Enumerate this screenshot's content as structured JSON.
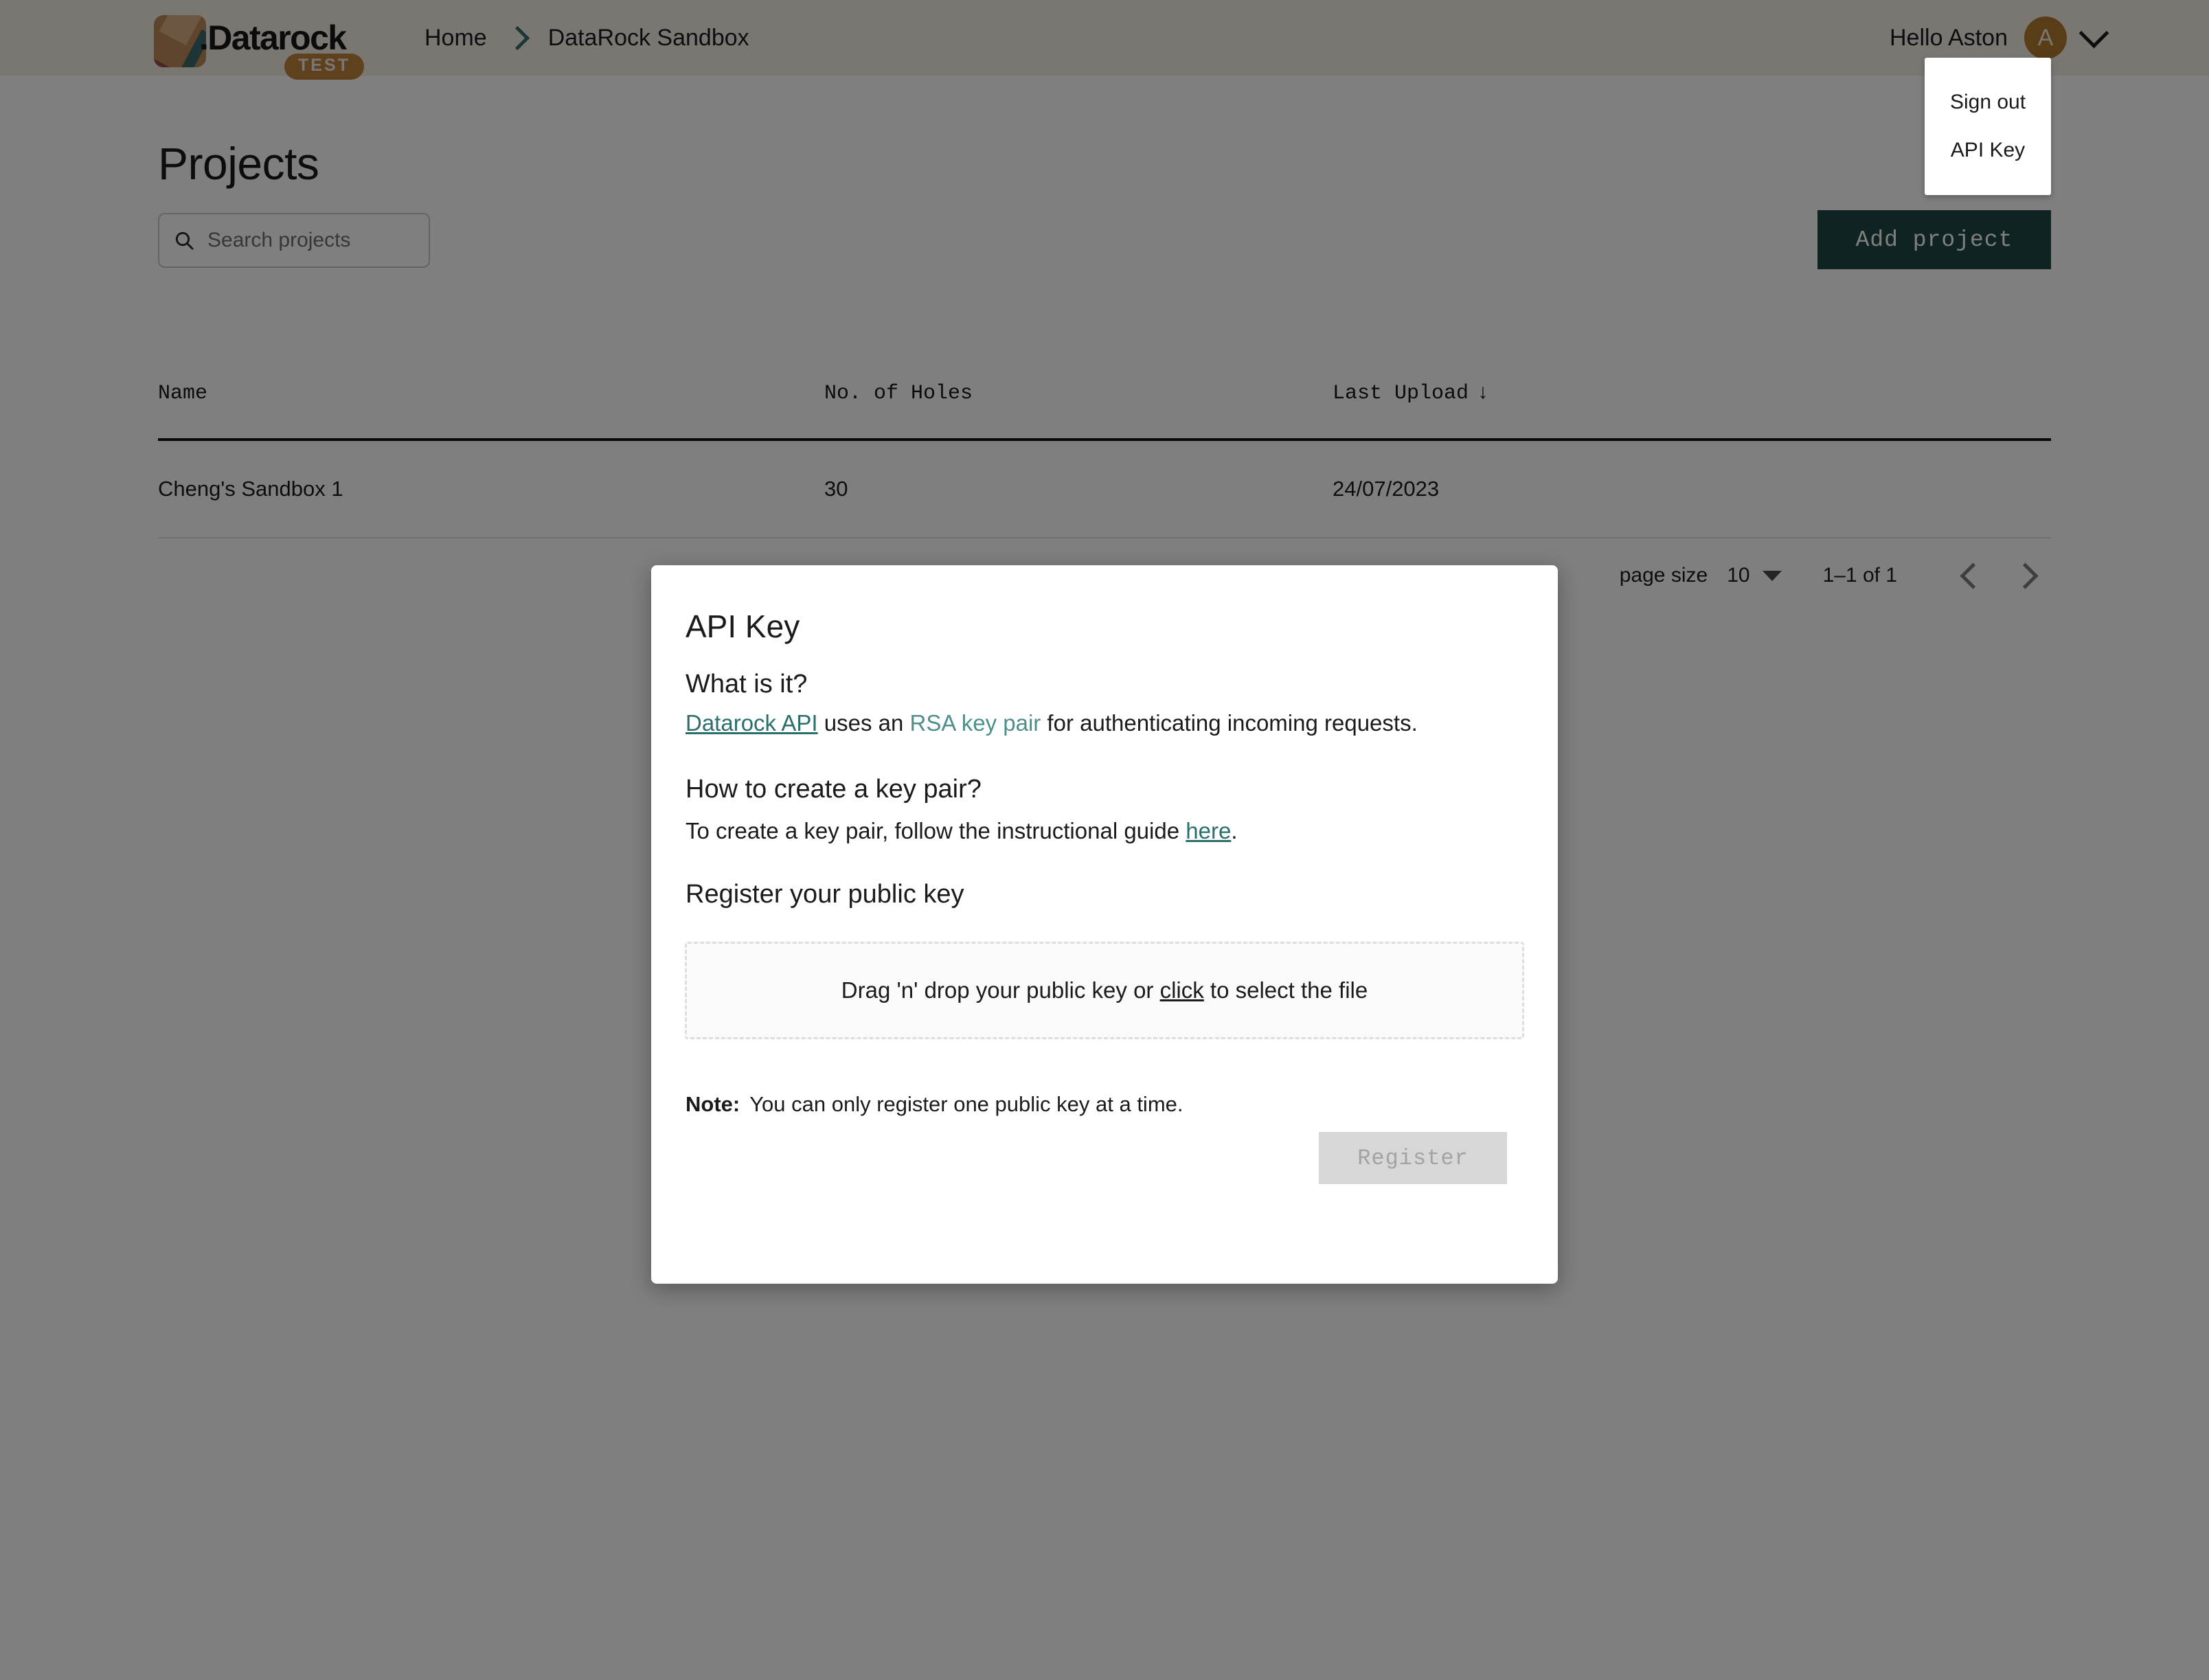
{
  "topbar": {
    "logo_word": ".Datarock",
    "logo_badge": "TEST",
    "breadcrumb": [
      {
        "label": "Home",
        "icon": ""
      },
      {
        "label": "DataRock Sandbox",
        "icon": "chevron-right-icon"
      }
    ],
    "greeting": "Hello Aston",
    "avatar_initial": "A",
    "caret_icon": "chevron-down-icon"
  },
  "user_menu": {
    "items": [
      {
        "label": "Sign out"
      },
      {
        "label": "API Key"
      }
    ]
  },
  "page": {
    "title": "Projects"
  },
  "search": {
    "placeholder": "Search projects",
    "value": "",
    "icon": "search-icon"
  },
  "toolbar": {
    "add_project_label": "Add project"
  },
  "table": {
    "columns": [
      {
        "label": "Name",
        "sort": ""
      },
      {
        "label": "No. of Holes",
        "sort": ""
      },
      {
        "label": "Last Upload",
        "sort": "↓"
      }
    ],
    "rows": [
      {
        "name": "Cheng's Sandbox 1",
        "holes": "30",
        "last_upload": "24/07/2023"
      }
    ]
  },
  "pagination": {
    "page_size_label": "page size",
    "page_size_value": "10",
    "range": "1–1 of 1",
    "prev_icon": "chevron-left-icon",
    "next_icon": "chevron-right-icon"
  },
  "modal": {
    "title": "API Key",
    "what_heading": "What is it?",
    "what_body_pre": "",
    "what_link_1": "Datarock API",
    "what_body_mid": " uses an ",
    "what_link_2": "RSA key pair",
    "what_body_post": " for authenticating incoming requests.",
    "how_heading": "How to create a key pair?",
    "how_body_pre": "To create a key pair, follow the instructional guide ",
    "how_link": "here",
    "how_body_post": ".",
    "register_heading": "Register your public key",
    "dropzone_pre": "Drag 'n' drop your public key or ",
    "dropzone_click": "click",
    "dropzone_post": " to select the file",
    "note_label": "Note:",
    "note_text": "You can only register one public key at a time.",
    "register_button_label": "Register"
  },
  "colors": {
    "brand_teal": "#1f4845",
    "link_teal": "#2a6f6c",
    "link_teal_light": "#4f8f8b",
    "avatar_bronze": "#b07a2d",
    "badge_bronze": "#c1833d",
    "topbar_bg": "#f4eee7",
    "overlay": "rgba(0,0,0,0.5)",
    "disabled_button": "#d7d7d7"
  }
}
